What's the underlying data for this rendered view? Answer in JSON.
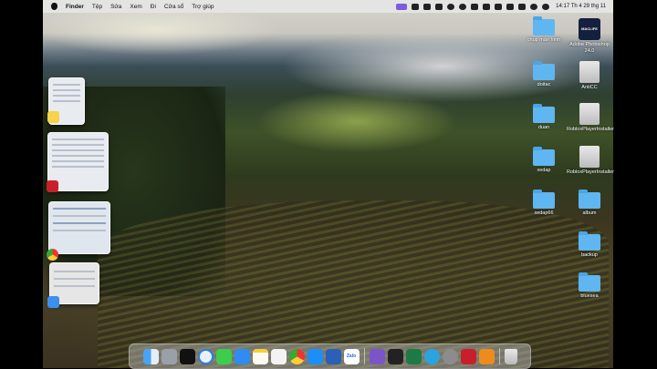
{
  "menubar": {
    "app_name": "Finder",
    "items": [
      "Tệp",
      "Sửa",
      "Xem",
      "Đi",
      "Cửa sổ",
      "Trợ giúp"
    ],
    "clock": "14:17 Th 4 29 thg 11"
  },
  "desktop_icons": [
    {
      "label": "chụp màn hình",
      "icon": "folder-icon"
    },
    {
      "label": "Adobe Photoshop 24.0",
      "icon": "photoshop-icon",
      "badge": "MACLIFE"
    },
    {
      "label": "doitac",
      "icon": "folder-icon"
    },
    {
      "label": "AntiCC",
      "icon": "disk-icon"
    },
    {
      "label": "duan",
      "icon": "folder-icon"
    },
    {
      "label": "RobloxPlayerInstaller",
      "icon": "disk-icon"
    },
    {
      "label": "xedap",
      "icon": "folder-icon"
    },
    {
      "label": "RobloxPlayerInstaller",
      "icon": "disk-icon"
    },
    {
      "label": "xedap66",
      "icon": "folder-icon"
    },
    {
      "label": "album",
      "icon": "folder-icon"
    },
    {
      "label": "backup",
      "icon": "folder-icon"
    },
    {
      "label": "bluesea",
      "icon": "folder-icon"
    }
  ],
  "dock": {
    "zalo_label": "Zalo",
    "apps": [
      "finder-icon",
      "launchpad-icon",
      "capcut-icon",
      "safari-icon",
      "messages-icon",
      "mail-icon",
      "notes-icon",
      "reminders-icon",
      "chrome-icon",
      "app-store-icon",
      "word-icon",
      "zalo-icon",
      "viber-icon",
      "terminal-icon",
      "excel-icon",
      "telegram-icon",
      "utility-icon",
      "filezilla-icon",
      "sublime-icon",
      "trash-icon"
    ]
  },
  "colors": {
    "folder": "#5fb6f0",
    "menu_highlight": "#7b5ce0"
  }
}
